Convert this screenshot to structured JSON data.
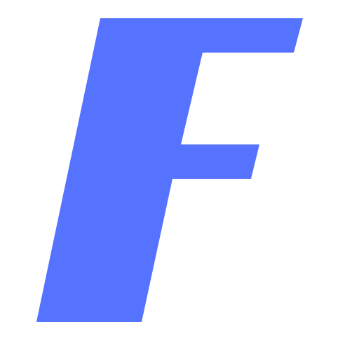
{
  "logo": {
    "letter": "F",
    "color": "#5673ff"
  }
}
